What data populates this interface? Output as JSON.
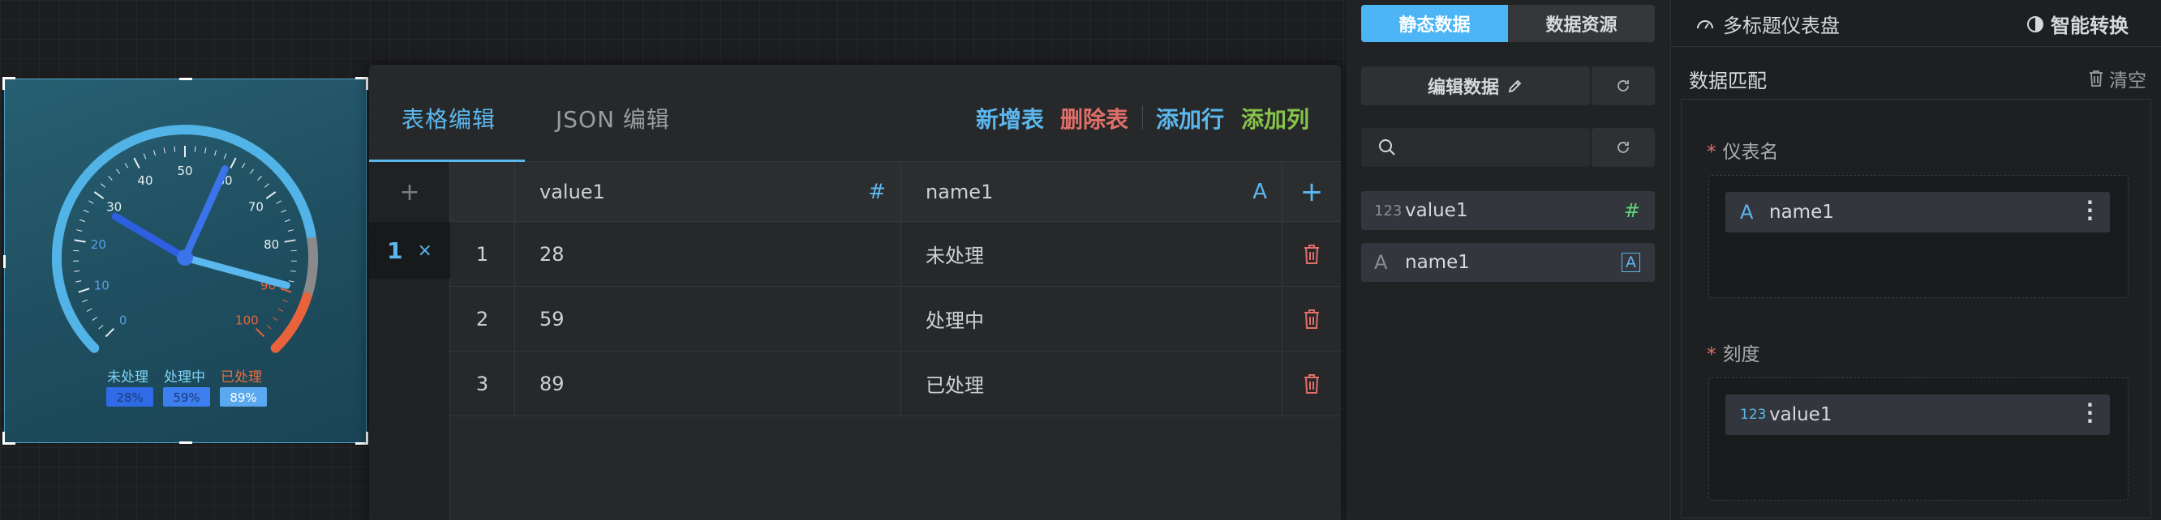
{
  "gauge": {
    "ticks": [
      "0",
      "10",
      "20",
      "30",
      "40",
      "50",
      "60",
      "70",
      "80",
      "90",
      "100"
    ],
    "values": [
      28,
      59,
      89
    ],
    "legend": [
      {
        "name": "未处理",
        "pct": "28%",
        "color": "#2f6be6",
        "text_color": "#7fd3f7"
      },
      {
        "name": "处理中",
        "pct": "59%",
        "color": "#3d7ff0",
        "text_color": "#7fd3f7"
      },
      {
        "name": "已处理",
        "pct": "89%",
        "color": "#5aa8ef",
        "text_color": "#ea6c3d"
      }
    ],
    "colors": {
      "arc_main": "#52b3e6",
      "arc_warn": "#8a8a8a",
      "arc_danger": "#e8623b",
      "needle_short": "#2d5fe0",
      "needle_mid": "#3a73ea",
      "needle_long": "#5bb8ee"
    }
  },
  "editor": {
    "tab_table": "表格编辑",
    "tab_json": "JSON 编辑",
    "add_table": "新增表",
    "delete_table": "删除表",
    "add_row": "添加行",
    "add_col": "添加列",
    "sheet_index": "1",
    "sheet_close": "×",
    "add_sheet": "+",
    "columns": [
      {
        "name": "value1",
        "type_icon": "#"
      },
      {
        "name": "name1",
        "type_icon": "A"
      }
    ],
    "add_column_icon": "+",
    "rows": [
      {
        "index": "1",
        "value1": "28",
        "name1": "未处理"
      },
      {
        "index": "2",
        "value1": "59",
        "name1": "处理中"
      },
      {
        "index": "3",
        "value1": "89",
        "name1": "已处理"
      }
    ]
  },
  "data_panel": {
    "tab_static": "静态数据",
    "tab_source": "数据资源",
    "edit_data": "编辑数据",
    "edit_icon": "pencil-icon",
    "search_placeholder": "",
    "fields": [
      {
        "type_label": "123",
        "name": "value1",
        "icon": "#"
      },
      {
        "type_label": "A",
        "name": "name1",
        "icon": "A"
      }
    ]
  },
  "config": {
    "title": "多标题仪表盘",
    "convert": "智能转换",
    "section_title": "数据匹配",
    "clear": "清空",
    "fields": [
      {
        "label": "仪表名",
        "required": "*",
        "chip_type": "A",
        "chip_name": "name1"
      },
      {
        "label": "刻度",
        "required": "*",
        "chip_type": "123",
        "chip_name": "value1"
      }
    ]
  }
}
